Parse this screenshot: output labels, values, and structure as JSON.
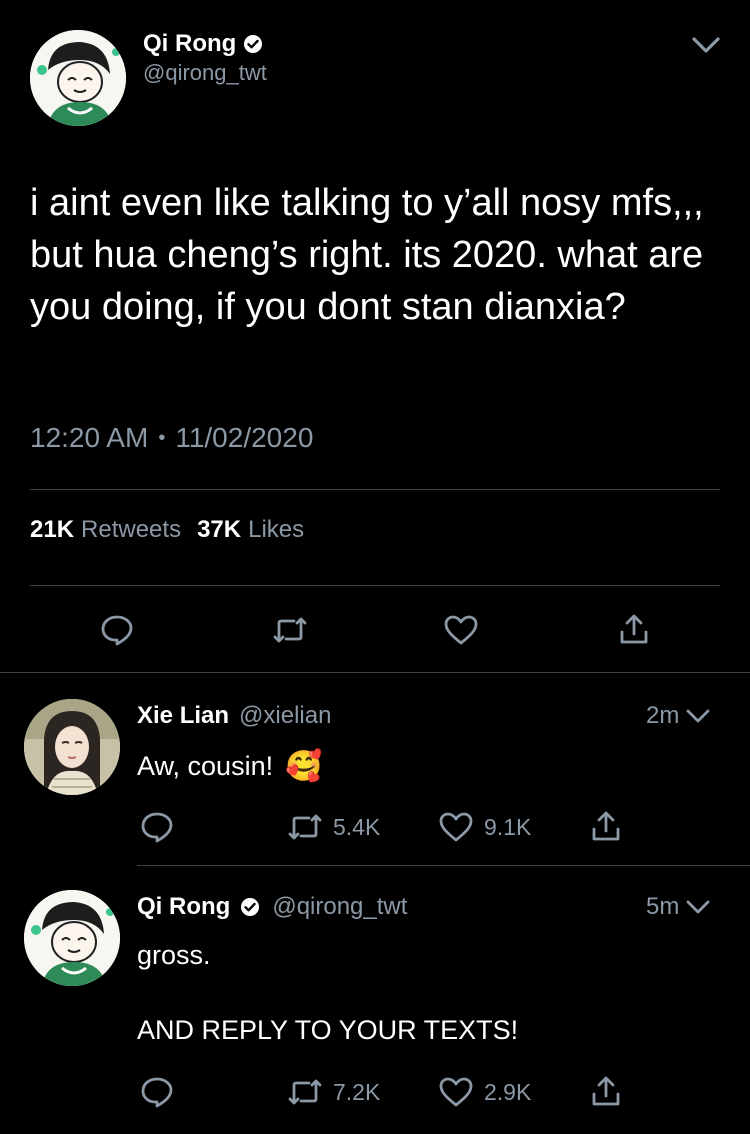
{
  "main_tweet": {
    "author": {
      "name": "Qi Rong",
      "handle": "@qirong_twt",
      "verified": true
    },
    "text": "i aint even like talking to y’all nosy mfs,,, but hua cheng’s right. its 2020. what are you doing, if you dont stan dianxia?",
    "time": "12:20 AM",
    "date": "11/02/2020",
    "separator": "•",
    "stats": {
      "retweets_count": "21K",
      "retweets_label": "Retweets",
      "likes_count": "37K",
      "likes_label": "Likes"
    }
  },
  "replies": [
    {
      "name": "Xie Lian",
      "handle": "@xielian",
      "verified": false,
      "age": "2m",
      "text": "Aw, cousin!",
      "emoji": "🥰",
      "retweets": "5.4K",
      "likes": "9.1K"
    },
    {
      "name": "Qi Rong",
      "handle": "@qirong_twt",
      "verified": true,
      "age": "5m",
      "text_line1": "gross.",
      "text_line2": "AND REPLY TO YOUR TEXTS!",
      "retweets": "7.2K",
      "likes": "2.9K"
    }
  ],
  "colors": {
    "background": "#000000",
    "text": "#ffffff",
    "muted": "#8b98a5",
    "divider": "#38444d"
  }
}
